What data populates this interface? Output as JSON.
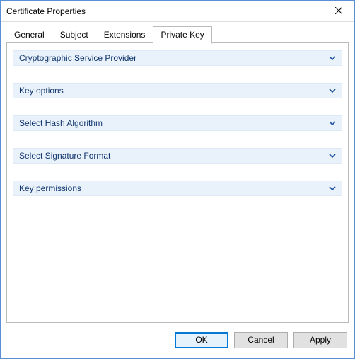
{
  "window": {
    "title": "Certificate Properties"
  },
  "tabs": [
    {
      "label": "General"
    },
    {
      "label": "Subject"
    },
    {
      "label": "Extensions"
    },
    {
      "label": "Private Key"
    }
  ],
  "active_tab_index": 3,
  "expanders": [
    {
      "label": "Cryptographic Service Provider"
    },
    {
      "label": "Key options"
    },
    {
      "label": "Select Hash Algorithm"
    },
    {
      "label": "Select Signature Format"
    },
    {
      "label": "Key permissions"
    }
  ],
  "buttons": {
    "ok": "OK",
    "cancel": "Cancel",
    "apply": "Apply"
  }
}
